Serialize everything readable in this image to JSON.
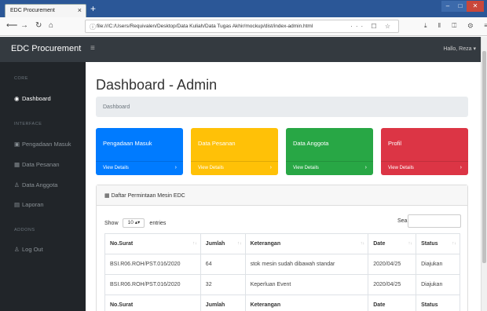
{
  "browser": {
    "tab_title": "EDC Procurement",
    "tab_close": "×",
    "new_tab": "+",
    "url": "file:///C:/Users/Requivalen/Desktop/Data Kuliah/Data Tugas Akhir/mockup/dist/index-admin.html",
    "url_icons": "··· ☐ ☆"
  },
  "app": {
    "brand": "EDC Procurement",
    "user_menu": "Hallo, Reza ▾"
  },
  "sidebar": {
    "heading_core": "CORE",
    "heading_interface": "INTERFACE",
    "heading_addons": "ADDONS",
    "items": [
      {
        "label": "Dashboard",
        "icon": "dashboard-icon"
      },
      {
        "label": "Pengadaan Masuk",
        "icon": "table-icon"
      },
      {
        "label": "Data Pesanan",
        "icon": "grid-icon"
      },
      {
        "label": "Data Anggota",
        "icon": "user-icon"
      },
      {
        "label": "Laporan",
        "icon": "report-icon"
      },
      {
        "label": "Log Out",
        "icon": "user-icon"
      }
    ]
  },
  "main": {
    "title": "Dashboard - Admin",
    "breadcrumb": "Dashboard",
    "cards": [
      {
        "title": "Pengadaan Masuk",
        "link": "View Details",
        "color": "#007bff"
      },
      {
        "title": "Data Pesanan",
        "link": "View Details",
        "color": "#ffc107"
      },
      {
        "title": "Data Anggota",
        "link": "View Details",
        "color": "#28a745"
      },
      {
        "title": "Profil",
        "link": "View Details",
        "color": "#dc3545"
      }
    ]
  },
  "table_card": {
    "title": "Daftar Permintaan Mesin EDC",
    "show_label": "Show",
    "entries_value": "10",
    "entries_label": "entries",
    "search_label": "Search:",
    "columns": [
      "No.Surat",
      "Jumlah",
      "Keterangan",
      "Date",
      "Status"
    ],
    "rows": [
      [
        "BSI.R06.ROH/PST.016/2020",
        "64",
        "stok mesin sudah dibawah standar",
        "2020/04/25",
        "Diajukan"
      ],
      [
        "BSI.R06.ROH/PST.016/2020",
        "32",
        "Keperluan Event",
        "2020/04/25",
        "Diajukan"
      ]
    ]
  }
}
